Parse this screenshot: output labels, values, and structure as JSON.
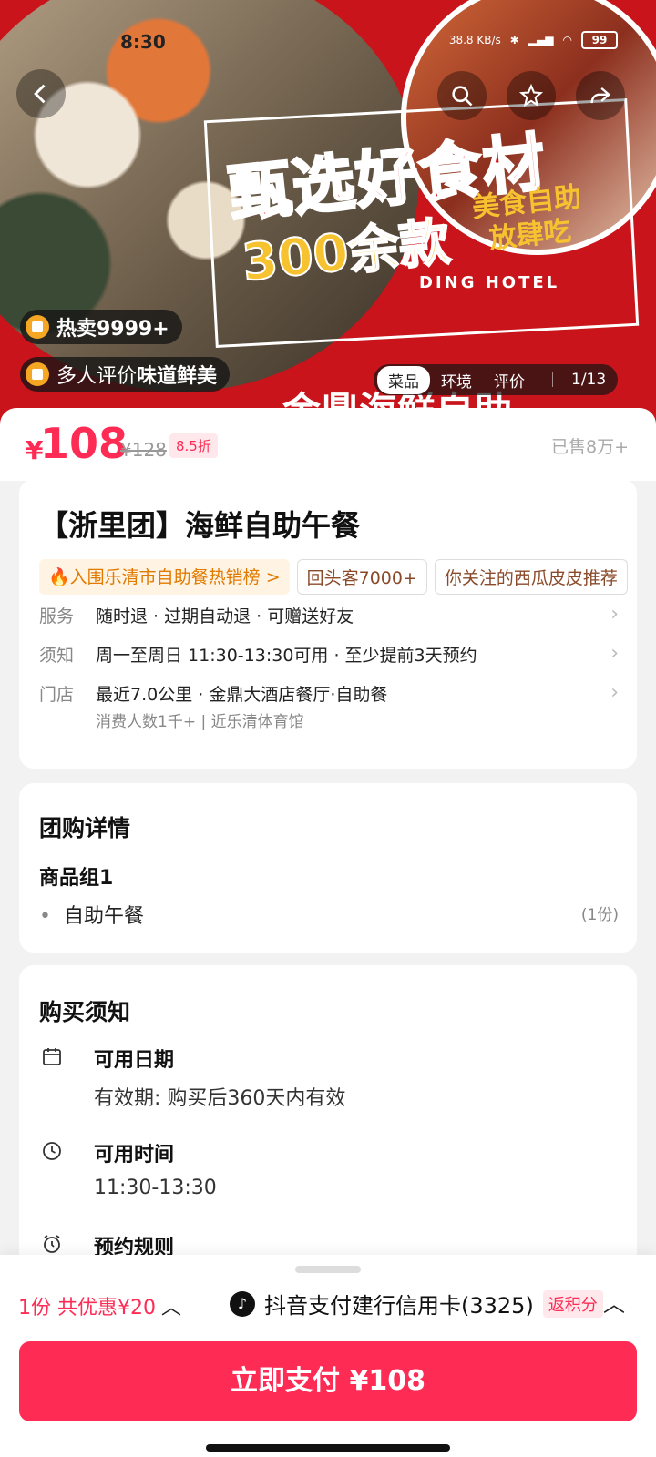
{
  "status": {
    "time": "8:30",
    "net": "38.8 KB/s",
    "battery": "99"
  },
  "hero": {
    "title1": "甄选好食材",
    "title2": "300余款",
    "subtitle_line1": "美食自助",
    "subtitle_line2": "放肆吃",
    "hotel": "DING HOTEL",
    "bottom_text": "金鼎海鲜自助",
    "badge_hot": "热卖9999+",
    "badge_review_prefix": "多人评价",
    "badge_review_highlight": "味道鲜美",
    "tabs": [
      "菜品",
      "环境",
      "评价"
    ],
    "page_count": "1/13"
  },
  "price": {
    "currency": "¥",
    "amount": "108",
    "original": "¥128",
    "discount": "8.5折",
    "sold": "已售8万+"
  },
  "product": {
    "title": "【浙里团】海鲜自助午餐",
    "tags": [
      "🔥入围乐清市自助餐热销榜 >",
      "回头客7000+",
      "你关注的西瓜皮皮推荐"
    ],
    "service_label": "服务",
    "service_value": "随时退 · 过期自动退 · 可赠送好友",
    "notice_label": "须知",
    "notice_value": "周一至周日 11:30-13:30可用 · 至少提前3天预约",
    "store_label": "门店",
    "store_value": "最近7.0公里 · 金鼎大酒店餐厅·自助餐",
    "store_sub": "消费人数1千+  |  近乐清体育馆"
  },
  "group": {
    "heading": "团购详情",
    "group_name": "商品组1",
    "item": "自助午餐",
    "qty": "(1份)"
  },
  "purchase": {
    "heading": "购买须知",
    "date_title": "可用日期",
    "date_value": "有效期: 购买后360天内有效",
    "time_title": "可用时间",
    "time_value": "11:30-13:30",
    "rule_title": "预约规则"
  },
  "bottom": {
    "coupon": "1份 共优惠¥20",
    "pay_method": "抖音支付建行信用卡(3325)",
    "points": "返积分",
    "pay_button": "立即支付 ¥108"
  },
  "colors": {
    "accent": "#fe2c55",
    "hero_red": "#c8141a",
    "tag_orange": "#e07a00"
  }
}
